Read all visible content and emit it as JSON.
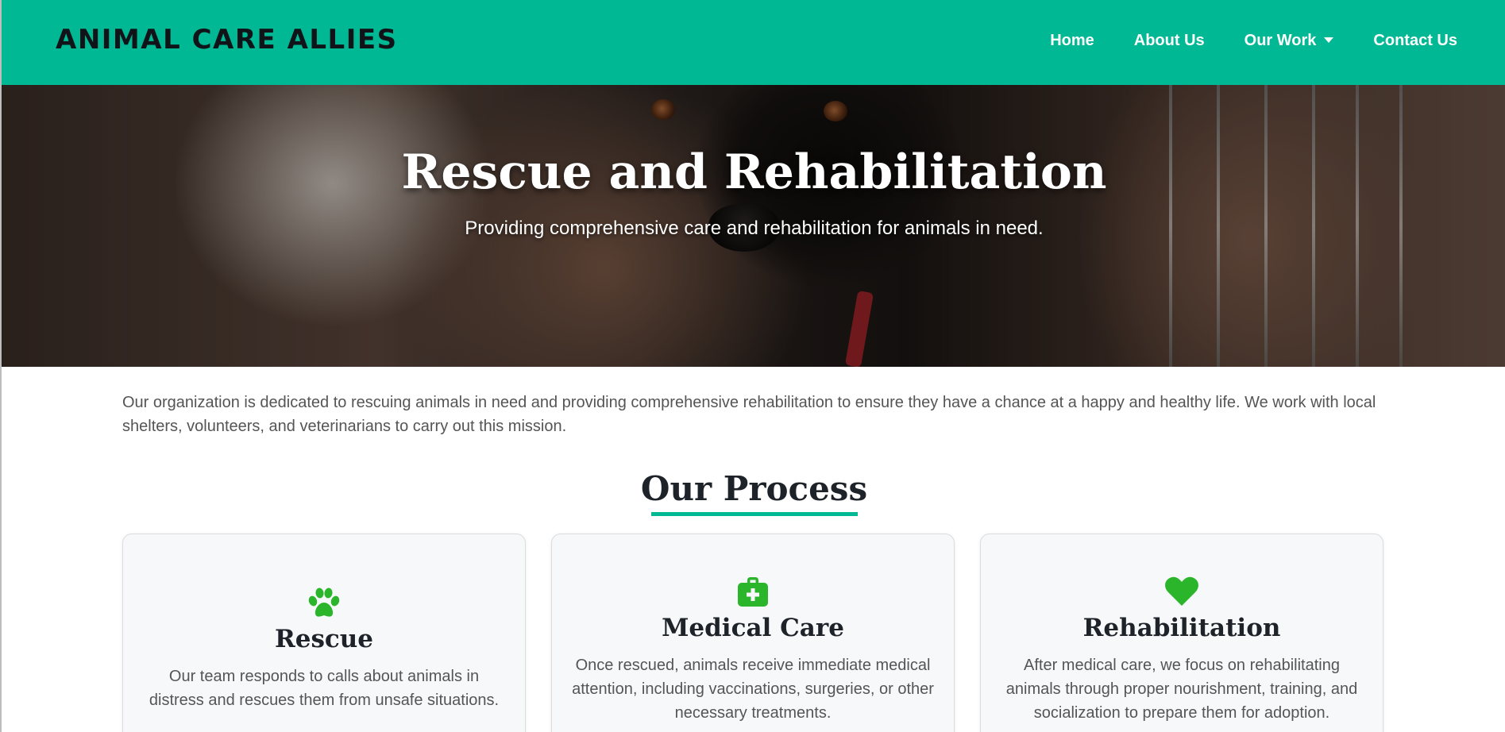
{
  "brand": "ANIMAL CARE ALLIES",
  "nav": {
    "home": "Home",
    "about": "About Us",
    "our_work": "Our Work",
    "contact": "Contact Us"
  },
  "hero": {
    "title": "Rescue and Rehabilitation",
    "subtitle": "Providing comprehensive care and rehabilitation for animals in need."
  },
  "intro": "Our organization is dedicated to rescuing animals in need and providing comprehensive rehabilitation to ensure they have a chance at a happy and healthy life. We work with local shelters, volunteers, and veterinarians to carry out this mission.",
  "process": {
    "title": "Our Process",
    "cards": [
      {
        "icon": "paw-icon",
        "title": "Rescue",
        "text": "Our team responds to calls about animals in distress and rescues them from unsafe situations."
      },
      {
        "icon": "medical-kit-icon",
        "title": "Medical Care",
        "text": "Once rescued, animals receive immediate medical attention, including vaccinations, surgeries, or other necessary treatments."
      },
      {
        "icon": "heart-icon",
        "title": "Rehabilitation",
        "text": "After medical care, we focus on rehabilitating animals through proper nourishment, training, and socialization to prepare them for adoption."
      }
    ]
  },
  "colors": {
    "accent": "#00b894",
    "icon": "#2bb52b",
    "heading": "#1e232a"
  }
}
